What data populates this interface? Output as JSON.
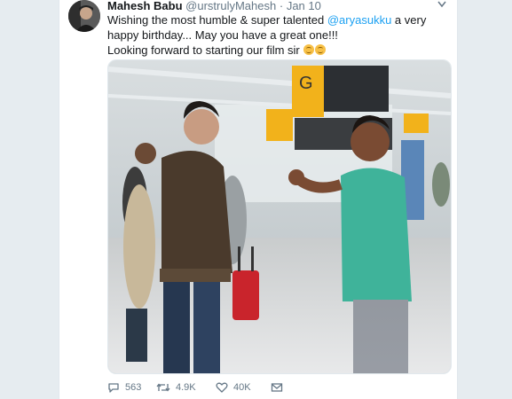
{
  "tweet": {
    "author_name": "Mahesh Babu",
    "handle": "@urstrulyMahesh",
    "separator": "·",
    "date": "Jan 10",
    "text_before_mention": "Wishing the most humble & super talented ",
    "mention": "@aryasukku",
    "text_after_mention": " a very happy birthday... May you have a great one!!!",
    "text_line2": "Looking forward to starting our film sir",
    "icons": {
      "avatar": "avatar-image",
      "menu": "chevron-down-icon",
      "reply": "reply-icon",
      "retweet": "retweet-icon",
      "like": "heart-icon",
      "dm": "envelope-icon"
    }
  },
  "stats": {
    "replies": "563",
    "retweets": "4.9K",
    "likes": "40K"
  },
  "colors": {
    "link": "#1da1f2",
    "secondary_text": "#657786",
    "primary_text": "#14171a",
    "background": "#e6ecf0"
  }
}
